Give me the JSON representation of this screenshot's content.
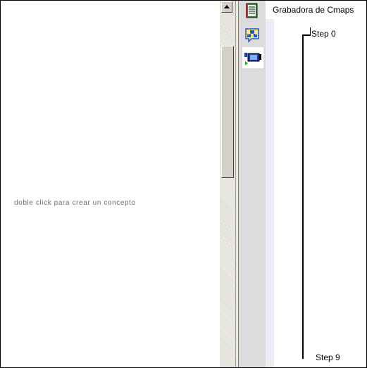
{
  "canvas": {
    "hint": "doble click para crear un concepto"
  },
  "toolbar": {
    "items": [
      {
        "icon": "document-list-icon",
        "accent": "#2e8b2e"
      },
      {
        "icon": "cmap-browser-icon",
        "accent": "#1e58c8"
      },
      {
        "icon": "video-recorder-icon",
        "accent": "#1e3c9c",
        "selected": true
      }
    ]
  },
  "recorder": {
    "title": "Grabadora de Cmaps",
    "steps": [
      "Step 0",
      "Step 9"
    ]
  }
}
